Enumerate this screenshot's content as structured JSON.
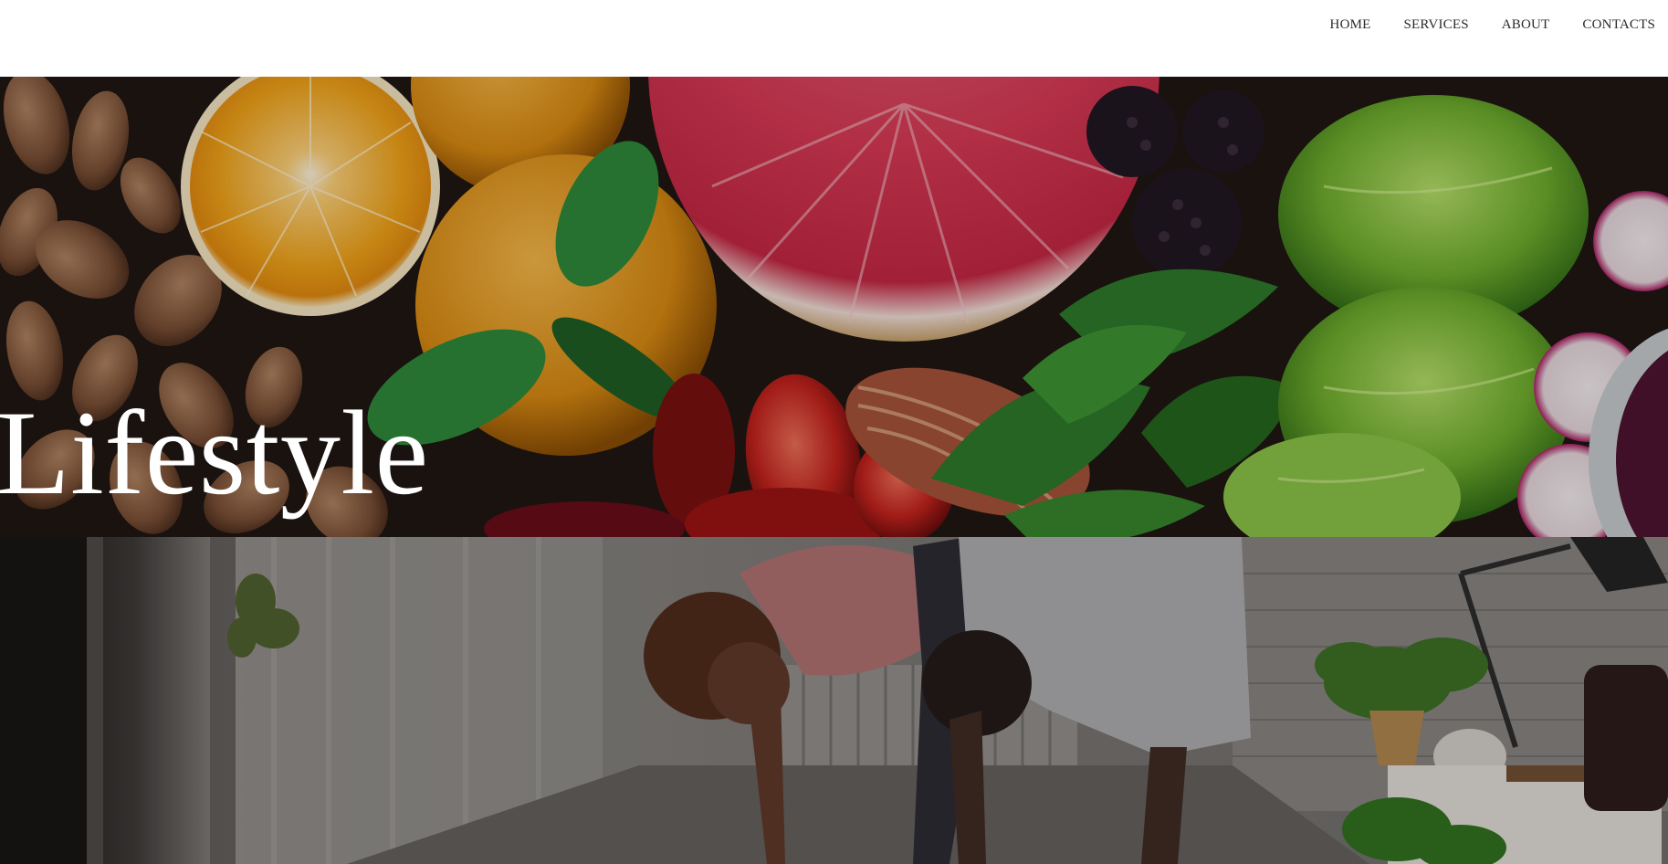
{
  "nav": {
    "items": [
      {
        "label": "HOME"
      },
      {
        "label": "SERVICES"
      },
      {
        "label": "ABOUT"
      },
      {
        "label": "CONTACTS"
      }
    ]
  },
  "hero": {
    "title": "Lifestyle",
    "image": "fruits-and-vegetables-photo"
  },
  "section2": {
    "image": "couple-stretching-photo"
  }
}
